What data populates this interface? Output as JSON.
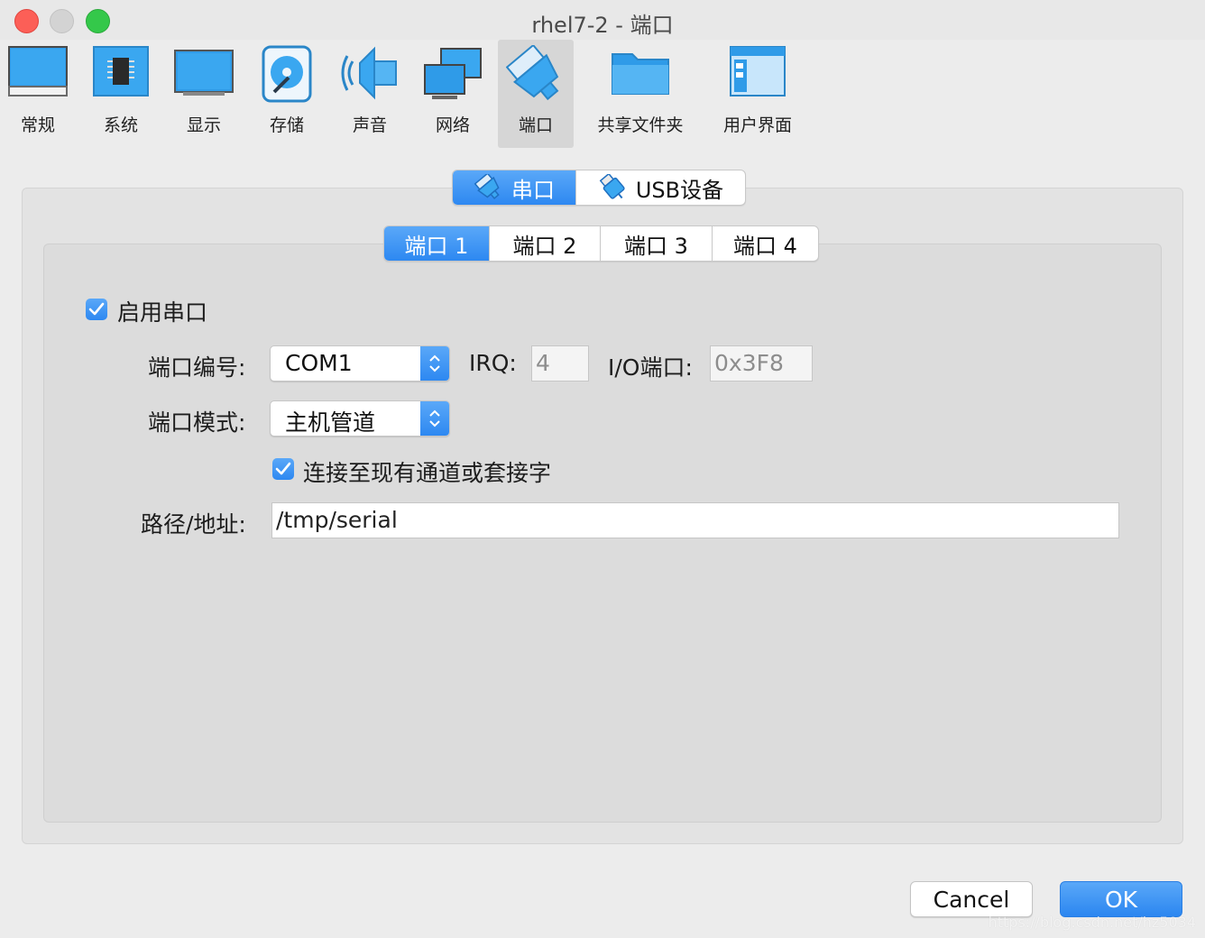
{
  "window": {
    "title": "rhel7-2 - 端口"
  },
  "toolbar": {
    "items": [
      {
        "label": "常规",
        "icon": "monitor-general-icon"
      },
      {
        "label": "系统",
        "icon": "chip-icon"
      },
      {
        "label": "显示",
        "icon": "display-icon"
      },
      {
        "label": "存储",
        "icon": "storage-disk-icon"
      },
      {
        "label": "声音",
        "icon": "speaker-icon"
      },
      {
        "label": "网络",
        "icon": "network-icon"
      },
      {
        "label": "端口",
        "icon": "serial-port-icon",
        "active": true
      },
      {
        "label": "共享文件夹",
        "icon": "folder-icon"
      },
      {
        "label": "用户界面",
        "icon": "user-interface-icon"
      }
    ]
  },
  "main_tabs": {
    "serial": "串口",
    "usb": "USB设备",
    "selected": "serial"
  },
  "port_tabs": {
    "items": [
      "端口 1",
      "端口 2",
      "端口 3",
      "端口 4"
    ],
    "selected_index": 0
  },
  "form": {
    "enable_serial": {
      "label": "启用串口",
      "checked": true
    },
    "port_number": {
      "label": "端口编号:",
      "value": "COM1"
    },
    "irq": {
      "label": "IRQ:",
      "value": "4"
    },
    "io_port": {
      "label": "I/O端口:",
      "value": "0x3F8"
    },
    "port_mode": {
      "label": "端口模式:",
      "value": "主机管道"
    },
    "connect_existing": {
      "label": "连接至现有通道或套接字",
      "checked": true
    },
    "path": {
      "label": "路径/地址:",
      "value": "/tmp/serial"
    }
  },
  "buttons": {
    "cancel": "Cancel",
    "ok": "OK"
  },
  "watermark": "https://blog.csdn.net/hz5034",
  "colors": {
    "accent": "#2d88f1",
    "accent_light": "#5aa8f8",
    "window_bg": "#ececec"
  }
}
